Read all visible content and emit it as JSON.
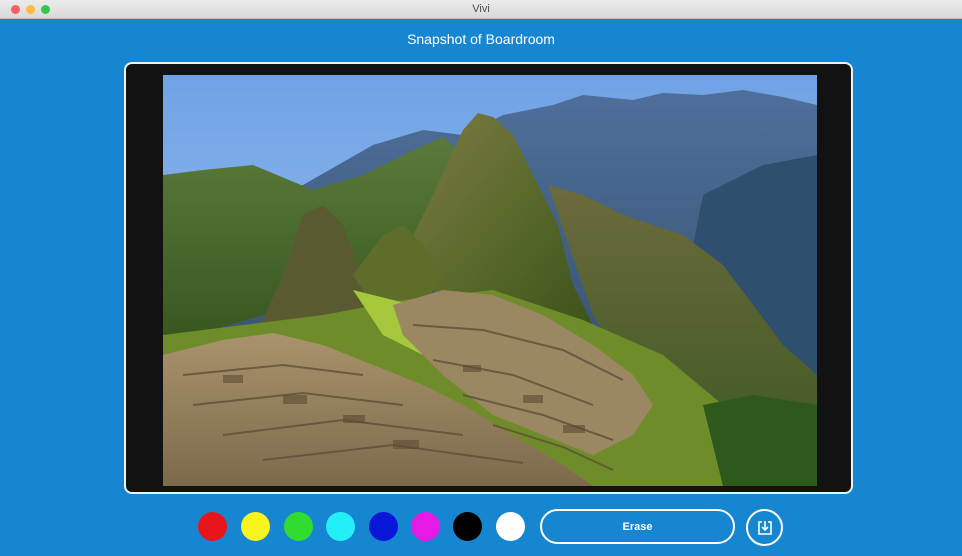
{
  "window": {
    "title": "Vivi"
  },
  "page": {
    "heading": "Snapshot of Boardroom"
  },
  "colors": {
    "background": "#1786d0",
    "frame_border": "#e9f2f9"
  },
  "snapshot": {
    "content": "mountain-landscape-image"
  },
  "toolbar": {
    "swatches": [
      {
        "name": "red",
        "color": "#e8141b"
      },
      {
        "name": "yellow",
        "color": "#f9f51c"
      },
      {
        "name": "green",
        "color": "#2fdc2f"
      },
      {
        "name": "cyan",
        "color": "#22f0f6"
      },
      {
        "name": "blue",
        "color": "#0a16d8"
      },
      {
        "name": "magenta",
        "color": "#e61ae6"
      },
      {
        "name": "black",
        "color": "#000000"
      },
      {
        "name": "white",
        "color": "#ffffff"
      }
    ],
    "erase_label": "Erase",
    "save_icon": "download-icon"
  }
}
